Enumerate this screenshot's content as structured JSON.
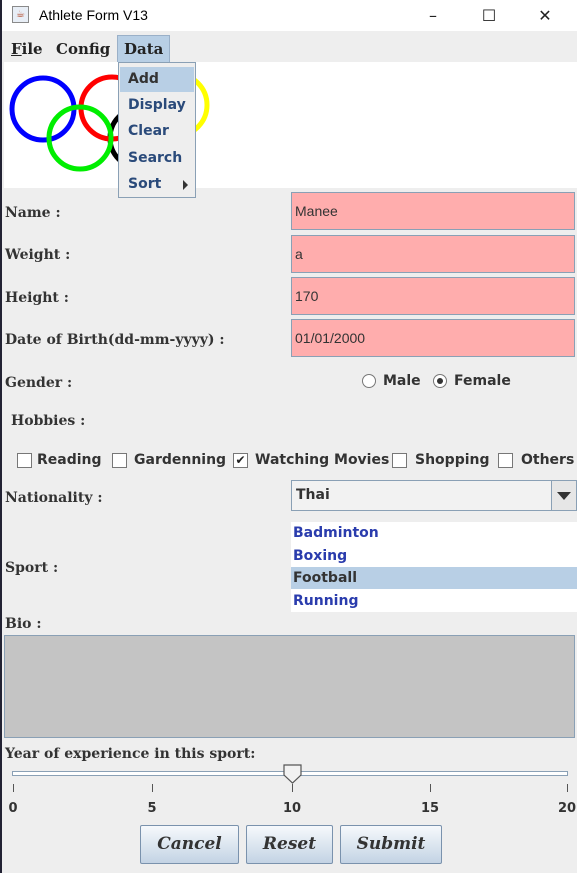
{
  "window": {
    "title": "Athlete Form V13",
    "controls": {
      "minimize": "–",
      "maximize": "☐",
      "close": "✕"
    }
  },
  "menubar": {
    "items": [
      {
        "label": "File",
        "mnemonic": "F"
      },
      {
        "label": "Config"
      },
      {
        "label": "Data"
      }
    ],
    "active": "Data"
  },
  "data_menu": {
    "items": [
      "Add",
      "Display",
      "Clear",
      "Search",
      "Sort"
    ],
    "highlighted": "Add"
  },
  "logo": {
    "rings": [
      "#0000ff",
      "#ff0000",
      "#ffff00",
      "#00ee00",
      "#000000"
    ]
  },
  "form": {
    "name": {
      "label": "Name :",
      "value": "Manee"
    },
    "weight": {
      "label": "Weight :",
      "value": "a"
    },
    "height": {
      "label": "Height :",
      "value": "170"
    },
    "dob": {
      "label": "Date of Birth(dd-mm-yyyy) :",
      "value": "01/01/2000"
    },
    "gender": {
      "label": "Gender :",
      "options": [
        "Male",
        "Female"
      ],
      "selected": "Female"
    },
    "hobbies": {
      "label": "Hobbies :",
      "options": [
        {
          "label": "Reading",
          "checked": false
        },
        {
          "label": "Gardenning",
          "checked": false
        },
        {
          "label": "Watching Movies",
          "checked": true
        },
        {
          "label": "Shopping",
          "checked": false
        },
        {
          "label": "Others",
          "checked": false
        }
      ]
    },
    "nationality": {
      "label": "Nationality :",
      "value": "Thai"
    },
    "sport": {
      "label": "Sport :",
      "options": [
        "Badminton",
        "Boxing",
        "Football",
        "Running"
      ],
      "selected": "Football"
    },
    "bio": {
      "label": "Bio :",
      "value": ""
    },
    "experience": {
      "label": "Year of experience in this sport:",
      "min": 0,
      "max": 20,
      "value": 10,
      "ticks": [
        "0",
        "5",
        "10",
        "15",
        "20"
      ]
    }
  },
  "buttons": {
    "cancel": "Cancel",
    "reset": "Reset",
    "submit": "Submit"
  },
  "colors": {
    "field_bg": "#ffadad",
    "selection": "#b8cfe5",
    "list_text": "#2a3cad",
    "bio_bg": "#c4c4c4"
  }
}
